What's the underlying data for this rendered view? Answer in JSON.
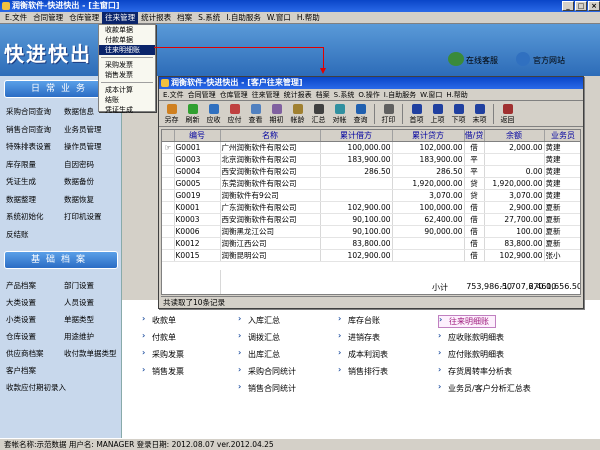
{
  "window": {
    "title": "润衡软件-快进快出 - [主窗口]"
  },
  "menu": [
    "E.文件",
    "合同管理",
    "仓库管理",
    "往来管理",
    "统计报表",
    "档案",
    "S.系统",
    "I.自助服务",
    "W.窗口",
    "H.帮助"
  ],
  "banner": {
    "logo": "快进快出",
    "support": "在线客服",
    "site": "官方网站"
  },
  "dropdown": {
    "group1": [
      "收款单据",
      "付款单据",
      "往来明细账"
    ],
    "group2": [
      "采购发票",
      "销售发票"
    ],
    "group3": [
      "成本计算",
      "结账",
      "凭证生成"
    ]
  },
  "sidebar": {
    "head1": "日常业务",
    "daily": [
      [
        "采购合同查询",
        "数据信息"
      ],
      [
        "销售合同查询",
        "业务员管理"
      ],
      [
        "特殊排表设置",
        "操作员管理"
      ],
      [
        "库存限量",
        "自因密码"
      ],
      [
        "凭证生成",
        "数据备份"
      ],
      [
        "数据整理",
        "数据恢复"
      ],
      [
        "系统初始化",
        "打印机设置"
      ],
      [
        "反结账",
        ""
      ]
    ],
    "head2": "基础档案",
    "archive": [
      [
        "产品档案",
        "部门设置"
      ],
      [
        "大类设置",
        "人员设置"
      ],
      [
        "小类设置",
        "单据类型"
      ],
      [
        "仓库设置",
        "用途维护"
      ],
      [
        "供应商档案",
        "收付款单据类型"
      ],
      [
        "客户档案",
        ""
      ],
      [
        "收款应付期初录入",
        ""
      ]
    ]
  },
  "child": {
    "title": "润衡软件-快进快出 - [客户往来管理]",
    "menu": [
      "E.文件",
      "合同管理",
      "仓库管理",
      "往来管理",
      "统计报表",
      "档案",
      "S.系统",
      "O.操作",
      "I.自助服务",
      "W.窗口",
      "H.帮助"
    ],
    "toolbar": [
      "另存",
      "刷新",
      "应收",
      "应付",
      "查看",
      "期初",
      "帐龄",
      "汇总",
      "对帐",
      "查询",
      "打印",
      "首项",
      "上项",
      "下项",
      "末项",
      "返回"
    ],
    "columns": [
      "编号",
      "名称",
      "累计借方",
      "累计贷方",
      "借/贷",
      "余额",
      "业务员"
    ],
    "rows": [
      [
        "G0001",
        "广州润衡软件有限公司",
        "100,000.00",
        "102,000.00",
        "借",
        "2,000.00",
        "黄建"
      ],
      [
        "G0003",
        "北京润衡软件有限公司",
        "183,900.00",
        "183,900.00",
        "平",
        "",
        "黄建"
      ],
      [
        "G0004",
        "西安润衡软件有限公司",
        "286.50",
        "286.50",
        "平",
        "0.00",
        "黄建"
      ],
      [
        "G0005",
        "东莞润衡软件有限公司",
        "",
        "1,920,000.00",
        "贷",
        "1,920,000.00",
        "黄建"
      ],
      [
        "G0019",
        "润衡软件有9公司",
        "",
        "3,070.00",
        "贷",
        "3,070.00",
        "黄建"
      ],
      [
        "K0001",
        "广东润衡软件有限公司",
        "102,900.00",
        "100,000.00",
        "借",
        "2,900.00",
        "夏新"
      ],
      [
        "K0003",
        "西安润衡软件有限公司",
        "90,100.00",
        "62,400.00",
        "借",
        "27,700.00",
        "夏新"
      ],
      [
        "K0006",
        "润衡黑龙江公司",
        "90,100.00",
        "90,000.00",
        "借",
        "100.00",
        "夏新"
      ],
      [
        "K0012",
        "润衡江西公司",
        "83,800.00",
        "",
        "借",
        "83,800.00",
        "夏新"
      ],
      [
        "K0015",
        "润衡昆明公司",
        "102,900.00",
        "",
        "借",
        "102,900.00",
        "张小"
      ]
    ],
    "total": {
      "label": "小计",
      "debit": "753,986.50",
      "credit": "2,461,656.50",
      "balance": "-1,707,670.00"
    },
    "status": "共读取了10条记录"
  },
  "quicklinks": [
    [
      "收款单",
      "入库汇总",
      "库存台账",
      "往来明细账"
    ],
    [
      "付款单",
      "调拨汇总",
      "进销存表",
      "应收账款明细表"
    ],
    [
      "采购发票",
      "出库汇总",
      "成本利润表",
      "应付账款明细表"
    ],
    [
      "销售发票",
      "采购合同统计",
      "销售排行表",
      "存货周转率分析表"
    ],
    [
      "",
      "销售合同统计",
      "",
      "业务员/客户分析汇总表"
    ]
  ],
  "status_bar": "套帐名称:示范数据   用户名: MANAGER   登录日期: 2012.08.07   ver.2012.04.25",
  "colors": {
    "title": "#0a46c8",
    "sidebar": "#c8d8ec",
    "header_text": "#0000a0",
    "arrow": "#e00000",
    "highlight": "#a02080"
  }
}
